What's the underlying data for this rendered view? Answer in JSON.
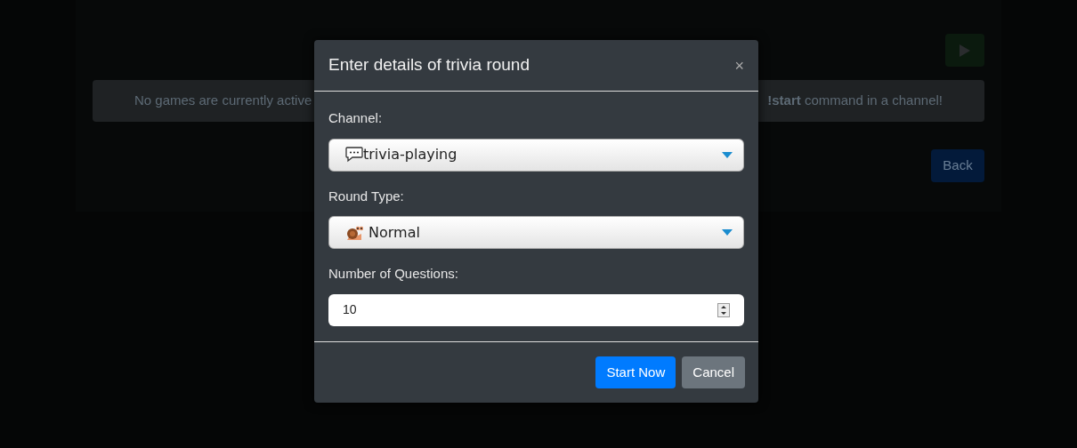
{
  "background": {
    "notice_left": "No games are currently active",
    "notice_right": "**!start** command in a channel!",
    "back_button": "Back"
  },
  "modal": {
    "title": "Enter details of trivia round",
    "close": "×",
    "fields": [
      {
        "kind": "select",
        "label": "Channel:",
        "value": "trivia-playing"
      },
      {
        "kind": "select",
        "label": "Round Type:",
        "value": "Normal"
      },
      {
        "kind": "number",
        "label": "Number of Questions:",
        "value": "10"
      }
    ],
    "buttons": [
      {
        "label": "Start Now",
        "kind": "primary"
      },
      {
        "label": "Cancel",
        "kind": "secondary"
      }
    ]
  }
}
